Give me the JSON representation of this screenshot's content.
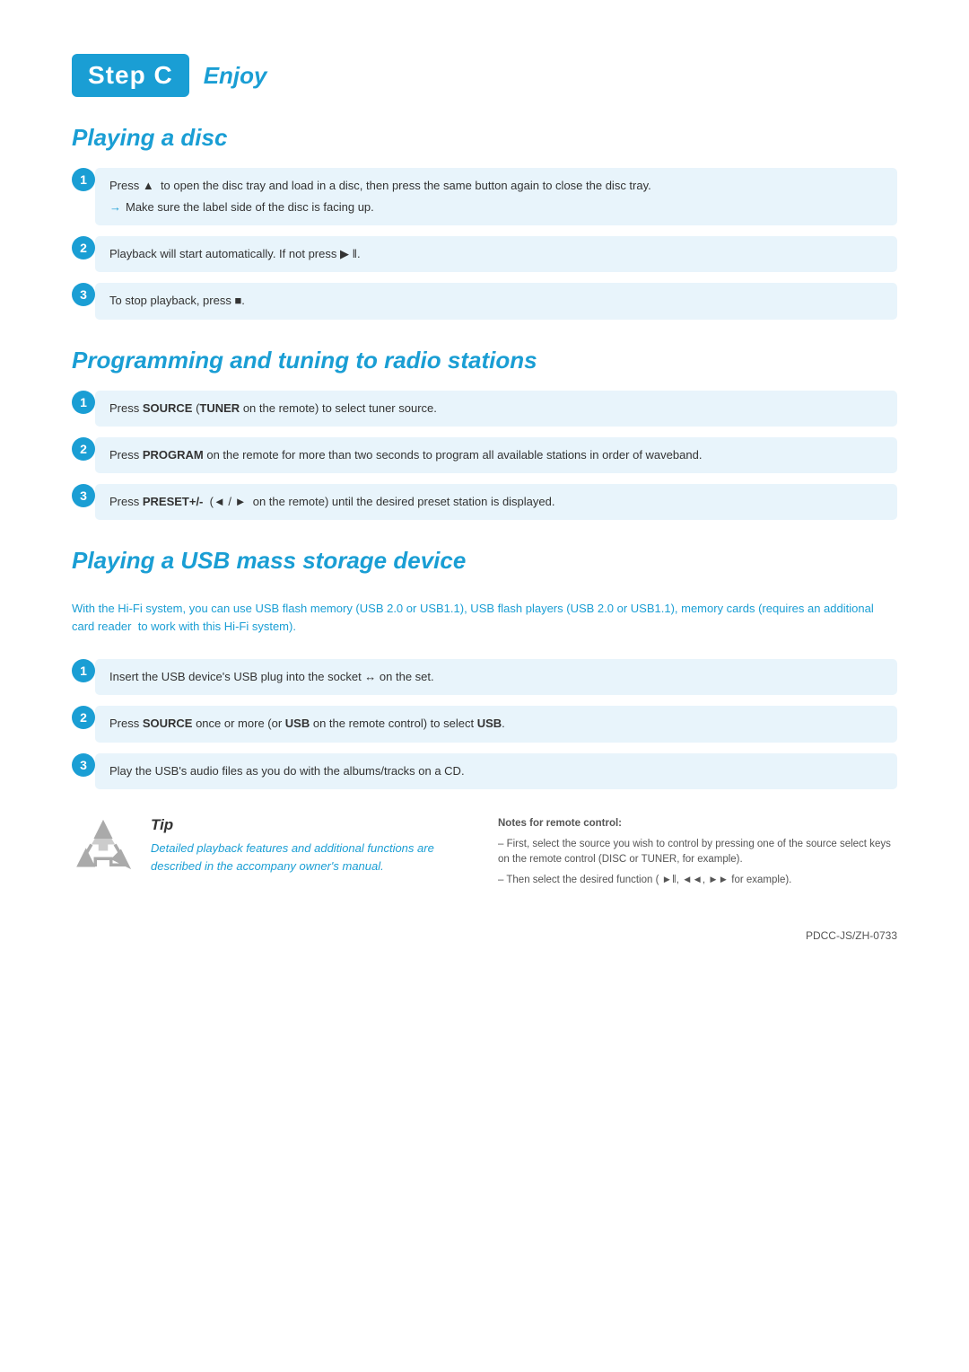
{
  "header": {
    "step": "Step C",
    "enjoy": "Enjoy"
  },
  "playing_disc": {
    "title": "Playing a disc",
    "steps": [
      {
        "num": "1",
        "text": "Press ▲  to open the disc tray and load in a disc, then press the same button again to close the disc tray.",
        "sub": "→ Make sure the label side of the disc is facing up."
      },
      {
        "num": "2",
        "text": "Playback will start automatically. If not press ▶ ‖."
      },
      {
        "num": "3",
        "text": "To stop playback, press ■."
      }
    ]
  },
  "programming_tuning": {
    "title": "Programming and tuning to radio stations",
    "steps": [
      {
        "num": "1",
        "text": "Press SOURCE (TUNER on the remote) to select tuner source.",
        "bold_parts": [
          "SOURCE",
          "TUNER"
        ]
      },
      {
        "num": "2",
        "text": "Press PROGRAM on the remote for more than two seconds to program all available stations in order of waveband.",
        "bold_parts": [
          "PROGRAM"
        ]
      },
      {
        "num": "3",
        "text": "Press PRESET+/-  (◄ / ►  on the remote) until the desired preset station is displayed.",
        "bold_parts": [
          "PRESET+/-"
        ]
      }
    ]
  },
  "playing_usb": {
    "title": "Playing a USB mass storage device",
    "intro": "With the Hi-Fi system, you can use USB flash memory (USB 2.0 or USB1.1), USB flash players (USB 2.0 or USB1.1), memory cards (requires an additional card reader  to work with this Hi-Fi system).",
    "steps": [
      {
        "num": "1",
        "text": "Insert the USB device's USB plug into the socket ↔ on the set."
      },
      {
        "num": "2",
        "text": "Press SOURCE once or more (or USB on the remote control) to select USB.",
        "bold_parts": [
          "SOURCE",
          "USB",
          "USB"
        ]
      },
      {
        "num": "3",
        "text": "Play the USB's audio files as you do with the albums/tracks on a CD."
      }
    ]
  },
  "tip": {
    "title": "Tip",
    "text": "Detailed playback features and additional functions are described in the accompany owner's manual."
  },
  "notes": {
    "title": "Notes for remote control:",
    "lines": [
      "–  First, select the source you wish to control by pressing one of the source select keys on the remote control (DISC or TUNER, for example).",
      "–  Then select the desired function (  ►‖, ◄◄,  ►► for example)."
    ]
  },
  "footer": {
    "code": "PDCC-JS/ZH-0733"
  }
}
